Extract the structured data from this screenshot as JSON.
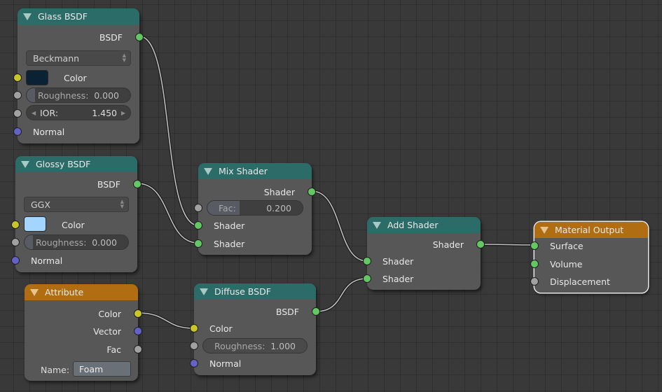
{
  "editor": "Node Editor",
  "colors": {
    "shader_header": "#2b6b68",
    "input_header": "#b06d12",
    "output_header": "#b06d12",
    "socket_shader": "#63c763",
    "socket_color": "#c7c729",
    "socket_vector": "#6363c7",
    "socket_value": "#a1a1a1",
    "glass_color": "#0a2233",
    "glossy_color": "#a3d5ff"
  },
  "nodes": {
    "glass": {
      "title": "Glass BSDF",
      "output": "BSDF",
      "distribution": "Beckmann",
      "color_label": "Color",
      "roughness_label": "Roughness:",
      "roughness_value": "0.000",
      "roughness_fraction": 0.0,
      "ior_label": "IOR:",
      "ior_value": "1.450",
      "normal_label": "Normal"
    },
    "glossy": {
      "title": "Glossy BSDF",
      "output": "BSDF",
      "distribution": "GGX",
      "color_label": "Color",
      "roughness_label": "Roughness:",
      "roughness_value": "0.000",
      "roughness_fraction": 0.0,
      "normal_label": "Normal"
    },
    "attribute": {
      "title": "Attribute",
      "outputs": [
        "Color",
        "Vector",
        "Fac"
      ],
      "name_label": "Name:",
      "name_value": "Foam"
    },
    "mix": {
      "title": "Mix Shader",
      "output": "Shader",
      "fac_label": "Fac:",
      "fac_value": "0.200",
      "fac_fraction": 0.2,
      "inputs": [
        "Shader",
        "Shader"
      ]
    },
    "diffuse": {
      "title": "Diffuse BSDF",
      "output": "BSDF",
      "color_label": "Color",
      "roughness_label": "Roughness:",
      "roughness_value": "1.000",
      "normal_label": "Normal"
    },
    "add": {
      "title": "Add Shader",
      "output": "Shader",
      "inputs": [
        "Shader",
        "Shader"
      ]
    },
    "output": {
      "title": "Material Output",
      "inputs": [
        "Surface",
        "Volume",
        "Displacement"
      ]
    }
  },
  "links": [
    {
      "from": "Glass BSDF.BSDF",
      "to": "Mix Shader.Shader[1]"
    },
    {
      "from": "Glossy BSDF.BSDF",
      "to": "Mix Shader.Shader[2]"
    },
    {
      "from": "Mix Shader.Shader",
      "to": "Add Shader.Shader[1]"
    },
    {
      "from": "Diffuse BSDF.BSDF",
      "to": "Add Shader.Shader[2]"
    },
    {
      "from": "Attribute.Color",
      "to": "Diffuse BSDF.Color"
    },
    {
      "from": "Add Shader.Shader",
      "to": "Material Output.Surface"
    }
  ]
}
